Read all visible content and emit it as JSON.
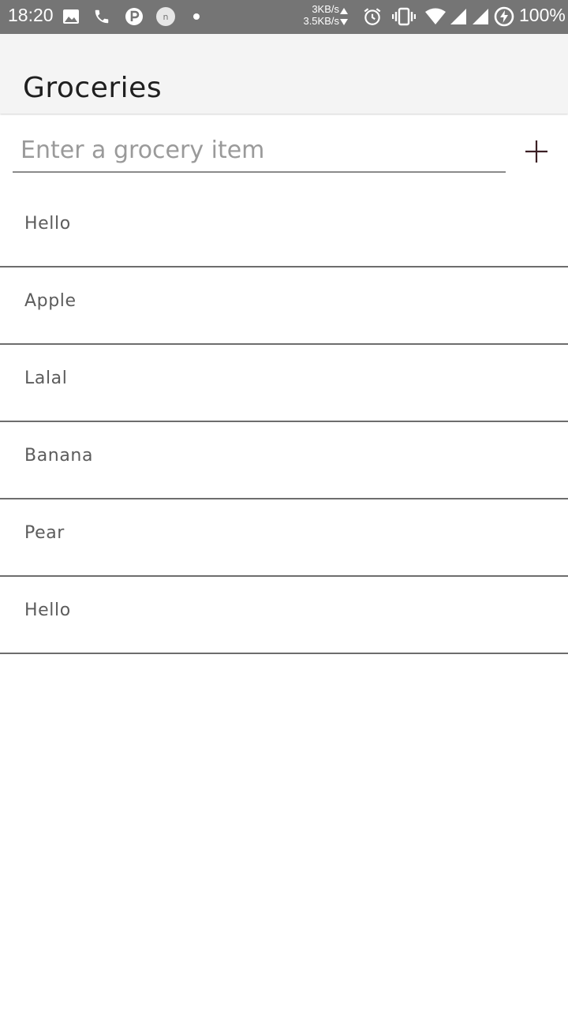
{
  "status_bar": {
    "time": "18:20",
    "net_up": "3KB/s",
    "net_down": "3.5KB/s",
    "battery": "100%",
    "icons": [
      "image-icon",
      "phone-icon",
      "p-app-icon",
      "n-app-icon",
      "dot-icon",
      "alarm-icon",
      "vibrate-icon",
      "wifi-icon",
      "signal-icon",
      "signal-icon",
      "battery-charging-icon"
    ]
  },
  "app_bar": {
    "title": "Groceries"
  },
  "input": {
    "placeholder": "Enter a grocery item",
    "value": ""
  },
  "add_button": {
    "icon": "plus-icon",
    "color": "#3b1f24"
  },
  "items": [
    {
      "label": "Hello"
    },
    {
      "label": "Apple"
    },
    {
      "label": "Lalal"
    },
    {
      "label": "Banana"
    },
    {
      "label": "Pear"
    },
    {
      "label": "Hello"
    }
  ]
}
